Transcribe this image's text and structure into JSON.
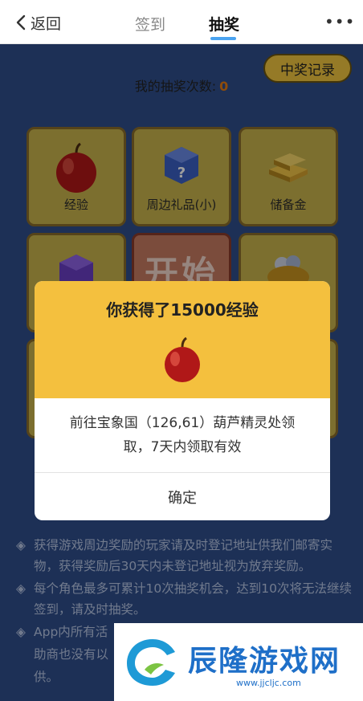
{
  "header": {
    "back_label": "返回",
    "tabs": [
      {
        "label": "签到",
        "active": false
      },
      {
        "label": "抽奖",
        "active": true
      }
    ],
    "more_label": "•••",
    "accent_color": "#4aa3f0"
  },
  "main": {
    "record_button": "中奖记录",
    "count_label": "我的抽奖次数:",
    "count_value": "0",
    "cells": [
      {
        "label": "经验",
        "icon": "apple-icon"
      },
      {
        "label": "周边礼品(小)",
        "icon": "mystery-box-icon"
      },
      {
        "label": "储备金",
        "icon": "gold-bars-icon"
      },
      {
        "label": "",
        "icon": "mystery-box-purple-icon"
      },
      {
        "label": "开始",
        "icon": ""
      },
      {
        "label": "",
        "icon": "treasure-pot-icon"
      }
    ],
    "notes": [
      "获得游戏周边奖励的玩家请及时登记地址供我们邮寄实物，获得奖励后30天内未登记地址视为放弃奖励。",
      "每个角色最多可累计10次抽奖机会，达到10次将无法继续签到，请及时抽奖。",
      "App内所有活",
      "助商也没有以",
      "供。"
    ]
  },
  "modal": {
    "title": "你获得了15000经验",
    "icon": "apple-icon",
    "description_line1": "前往宝象国（126,61）葫芦精灵处领",
    "description_line2": "取，7天内领取有效",
    "confirm_label": "确定",
    "header_color": "#f4c03e"
  },
  "watermark": {
    "name": "辰隆游戏网",
    "url": "www.jjcljc.com"
  }
}
